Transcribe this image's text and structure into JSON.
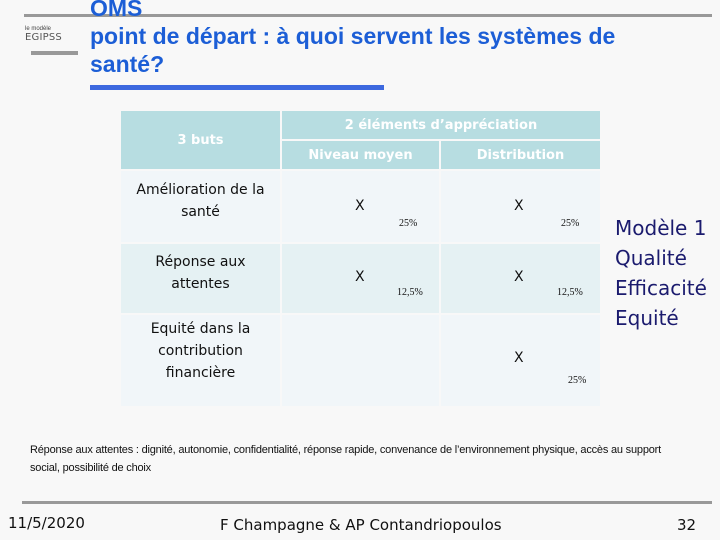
{
  "header": {
    "logo_small": "le modèle",
    "logo_main": "EGIPSS",
    "title_line1": "OMS",
    "title_line2": "point de départ : à quoi servent les systèmes de",
    "title_line3": "santé?"
  },
  "table": {
    "col_goals_header": "3 buts",
    "group_header": "2 éléments d’appréciation",
    "sub_headers": [
      "Niveau moyen",
      "Distribution"
    ],
    "rows": [
      {
        "goal_line1": "Amélioration de la",
        "goal_line2": "santé",
        "goal_line3": "",
        "niveau_mark": "X",
        "niveau_pct": "25%",
        "distribution_mark": "X",
        "distribution_pct": "25%"
      },
      {
        "goal_line1": "Réponse aux",
        "goal_line2": "attentes",
        "goal_line3": "",
        "niveau_mark": "X",
        "niveau_pct": "12,5%",
        "distribution_mark": "X",
        "distribution_pct": "12,5%"
      },
      {
        "goal_line1": "Equité dans la",
        "goal_line2": "contribution",
        "goal_line3": "financière",
        "niveau_mark": "",
        "niveau_pct": "",
        "distribution_mark": "X",
        "distribution_pct": "25%"
      }
    ]
  },
  "model": {
    "lines": [
      "Modèle 1",
      "Qualité",
      "Efficacité",
      "Equité"
    ]
  },
  "note": {
    "text": "Réponse aux attentes : dignité, autonomie, confidentialité, réponse rapide, convenance de l’environnement physique, accès au support social, possibilité de choix"
  },
  "footer": {
    "date": "11/5/2020",
    "authors": "F Champagne & AP Contandriopoulos",
    "page": "32"
  },
  "colors": {
    "title_blue": "#1c5ed6",
    "title_rule_blue": "#3d69df",
    "header_teal": "#b7dde1",
    "model_navy": "#1b1b6e"
  }
}
